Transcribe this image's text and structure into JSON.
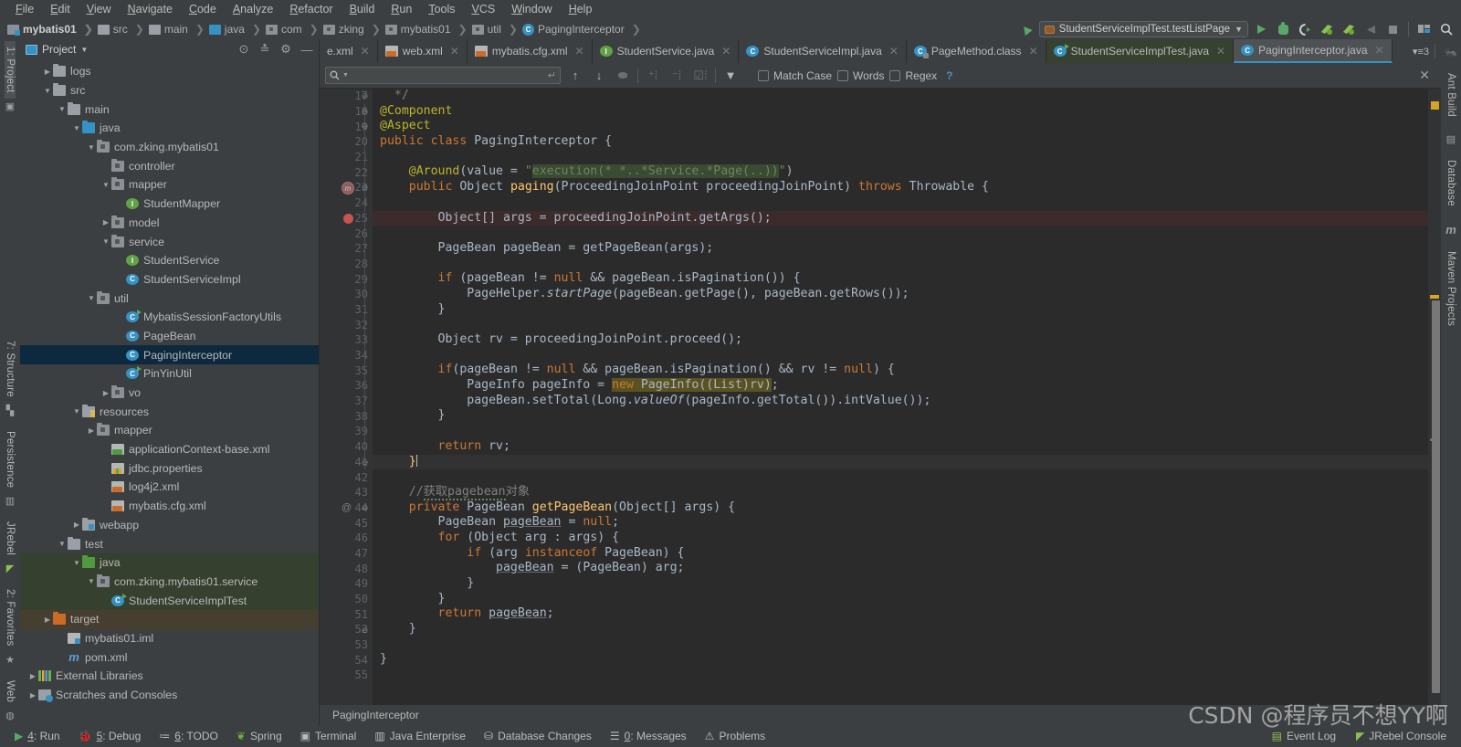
{
  "menu": {
    "items": [
      "File",
      "Edit",
      "View",
      "Navigate",
      "Code",
      "Analyze",
      "Refactor",
      "Build",
      "Run",
      "Tools",
      "VCS",
      "Window",
      "Help"
    ]
  },
  "breadcrumb": {
    "items": [
      {
        "label": "mybatis01",
        "icon": "module-icon"
      },
      {
        "label": "src",
        "icon": "folder-icon"
      },
      {
        "label": "main",
        "icon": "folder-icon"
      },
      {
        "label": "java",
        "icon": "source-folder-icon"
      },
      {
        "label": "com",
        "icon": "package-icon"
      },
      {
        "label": "zking",
        "icon": "package-icon"
      },
      {
        "label": "mybatis01",
        "icon": "package-icon"
      },
      {
        "label": "util",
        "icon": "package-icon"
      },
      {
        "label": "PagingInterceptor",
        "icon": "class-icon"
      }
    ]
  },
  "toolbar": {
    "run_config": "StudentServiceImplTest.testListPage",
    "buttons": [
      "run-button",
      "debug-button",
      "run-coverage-button",
      "run-with-jrebel-button",
      "debug-with-jrebel-button",
      "build-button",
      "stop-button",
      "select-target-button",
      "search-everywhere-button"
    ]
  },
  "left_rail": {
    "tabs": [
      "1: Project",
      "7: Structure",
      "Persistence",
      "JRebel",
      "2: Favorites",
      "Web"
    ]
  },
  "right_rail": {
    "tabs": [
      "Ant Build",
      "Database",
      "Maven Projects"
    ]
  },
  "project_panel": {
    "title": "Project",
    "tree": [
      {
        "label": "logs",
        "indent": 1,
        "arrow": "right",
        "icon": "folder"
      },
      {
        "label": "src",
        "indent": 1,
        "arrow": "down",
        "icon": "folder"
      },
      {
        "label": "main",
        "indent": 2,
        "arrow": "down",
        "icon": "folder"
      },
      {
        "label": "java",
        "indent": 3,
        "arrow": "down",
        "icon": "folder-blue"
      },
      {
        "label": "com.zking.mybatis01",
        "indent": 4,
        "arrow": "down",
        "icon": "package"
      },
      {
        "label": "controller",
        "indent": 5,
        "arrow": "none",
        "icon": "package"
      },
      {
        "label": "mapper",
        "indent": 5,
        "arrow": "down",
        "icon": "package"
      },
      {
        "label": "StudentMapper",
        "indent": 6,
        "arrow": "none",
        "icon": "interface"
      },
      {
        "label": "model",
        "indent": 5,
        "arrow": "right",
        "icon": "package"
      },
      {
        "label": "service",
        "indent": 5,
        "arrow": "down",
        "icon": "package"
      },
      {
        "label": "StudentService",
        "indent": 6,
        "arrow": "none",
        "icon": "interface"
      },
      {
        "label": "StudentServiceImpl",
        "indent": 6,
        "arrow": "none",
        "icon": "class"
      },
      {
        "label": "util",
        "indent": 4,
        "arrow": "down",
        "icon": "package"
      },
      {
        "label": "MybatisSessionFactoryUtils",
        "indent": 6,
        "arrow": "none",
        "icon": "class-runnable"
      },
      {
        "label": "PageBean",
        "indent": 6,
        "arrow": "none",
        "icon": "class"
      },
      {
        "label": "PagingInterceptor",
        "indent": 6,
        "arrow": "none",
        "icon": "class",
        "state": "selected"
      },
      {
        "label": "PinYinUtil",
        "indent": 6,
        "arrow": "none",
        "icon": "class-runnable"
      },
      {
        "label": "vo",
        "indent": 5,
        "arrow": "right",
        "icon": "package"
      },
      {
        "label": "resources",
        "indent": 3,
        "arrow": "down",
        "icon": "folder-resources"
      },
      {
        "label": "mapper",
        "indent": 4,
        "arrow": "right",
        "icon": "package"
      },
      {
        "label": "applicationContext-base.xml",
        "indent": 5,
        "arrow": "none",
        "icon": "xml-spring"
      },
      {
        "label": "jdbc.properties",
        "indent": 5,
        "arrow": "none",
        "icon": "properties"
      },
      {
        "label": "log4j2.xml",
        "indent": 5,
        "arrow": "none",
        "icon": "xml"
      },
      {
        "label": "mybatis.cfg.xml",
        "indent": 5,
        "arrow": "none",
        "icon": "xml"
      },
      {
        "label": "webapp",
        "indent": 3,
        "arrow": "right",
        "icon": "folder-web"
      },
      {
        "label": "test",
        "indent": 2,
        "arrow": "down",
        "icon": "folder"
      },
      {
        "label": "java",
        "indent": 3,
        "arrow": "down",
        "icon": "folder-green",
        "state": "green"
      },
      {
        "label": "com.zking.mybatis01.service",
        "indent": 4,
        "arrow": "down",
        "icon": "package",
        "state": "green"
      },
      {
        "label": "StudentServiceImplTest",
        "indent": 5,
        "arrow": "none",
        "icon": "class-runnable-green",
        "state": "green"
      },
      {
        "label": "target",
        "indent": 1,
        "arrow": "right",
        "icon": "folder-orange",
        "state": "brown"
      },
      {
        "label": "mybatis01.iml",
        "indent": 2,
        "arrow": "none",
        "icon": "iml"
      },
      {
        "label": "pom.xml",
        "indent": 2,
        "arrow": "none",
        "icon": "maven"
      },
      {
        "label": "External Libraries",
        "indent": 0,
        "arrow": "right",
        "icon": "libraries"
      },
      {
        "label": "Scratches and Consoles",
        "indent": 0,
        "arrow": "right",
        "icon": "scratches"
      }
    ]
  },
  "editor_tabs": [
    {
      "label": "e.xml",
      "icon": "xml",
      "state": "clipped"
    },
    {
      "label": "web.xml",
      "icon": "xml-web",
      "state": "normal"
    },
    {
      "label": "mybatis.cfg.xml",
      "icon": "xml",
      "state": "normal"
    },
    {
      "label": "StudentService.java",
      "icon": "interface",
      "state": "normal"
    },
    {
      "label": "StudentServiceImpl.java",
      "icon": "class",
      "state": "normal"
    },
    {
      "label": "PageMethod.class",
      "icon": "class-file",
      "state": "normal"
    },
    {
      "label": "StudentServiceImplTest.java",
      "icon": "class-runnable-green",
      "state": "green"
    },
    {
      "label": "PagingInterceptor.java",
      "icon": "class",
      "state": "selected"
    }
  ],
  "tabs_overflow_count": "3",
  "find_bar": {
    "placeholder": "",
    "value": "",
    "match_case": "Match Case",
    "words": "Words",
    "regex": "Regex",
    "help": "?"
  },
  "code": {
    "first_line": 17,
    "lines": [
      {
        "n": 17,
        "html": "  <span class='cm'>*/</span>"
      },
      {
        "n": 18,
        "html": "<span class='a'>@Component</span>"
      },
      {
        "n": 19,
        "html": "<span class='a'>@Aspect</span>"
      },
      {
        "n": 20,
        "html": "<span class='k'>public</span> <span class='k'>class</span> PagingInterceptor {"
      },
      {
        "n": 21,
        "html": ""
      },
      {
        "n": 22,
        "html": "    <span class='a'>@Around</span>(value = <span class='s'>\"</span><span class='sel s'>execution(* *..*Service.*Page(..))</span><span class='s'>\"</span>)"
      },
      {
        "n": 23,
        "html": "    <span class='k'>public</span> Object <span class='m'>paging</span>(ProceedingJoinPoint proceedingJoinPoint) <span class='k'>throws</span> Throwable {"
      },
      {
        "n": 24,
        "html": ""
      },
      {
        "n": 25,
        "html": "        Object[] args = proceedingJoinPoint.getArgs();",
        "hl": true
      },
      {
        "n": 26,
        "html": ""
      },
      {
        "n": 27,
        "html": "        PageBean pageBean = getPageBean(args);"
      },
      {
        "n": 28,
        "html": ""
      },
      {
        "n": 29,
        "html": "        <span class='k'>if</span> (pageBean != <span class='k'>null</span> &amp;&amp; pageBean.isPagination()) {"
      },
      {
        "n": 30,
        "html": "            PageHelper.<span style='font-style:italic'>startPage</span>(pageBean.getPage(), pageBean.getRows());"
      },
      {
        "n": 31,
        "html": "        }"
      },
      {
        "n": 32,
        "html": ""
      },
      {
        "n": 33,
        "html": "        Object rv = proceedingJoinPoint.proceed();"
      },
      {
        "n": 34,
        "html": ""
      },
      {
        "n": 35,
        "html": "        <span class='k'>if</span>(pageBean != <span class='k'>null</span> &amp;&amp; pageBean.isPagination() &amp;&amp; rv != <span class='k'>null</span>) {"
      },
      {
        "n": 36,
        "html": "            PageInfo pageInfo = <span class='hlw'><span class='k'>new</span> PageInfo((List)rv)</span>;"
      },
      {
        "n": 37,
        "html": "            pageBean.setTotal(Long.<span style='font-style:italic'>valueOf</span>(pageInfo.getTotal()).intValue());"
      },
      {
        "n": 38,
        "html": "        }"
      },
      {
        "n": 39,
        "html": ""
      },
      {
        "n": 40,
        "html": "        <span class='k'>return</span> rv;"
      },
      {
        "n": 41,
        "html": "    <span style='color:#ffc66d'>}</span><span class='caret'></span>",
        "cur": true
      },
      {
        "n": 42,
        "html": ""
      },
      {
        "n": 43,
        "html": "    <span class='cm'>//</span><span class='cm wavy'>获取pagebean</span><span class='cm'>对象</span>"
      },
      {
        "n": 44,
        "html": "    <span class='k'>private</span> PageBean <span class='m'>getPageBean</span>(Object[] args) {"
      },
      {
        "n": 45,
        "html": "        PageBean <span class='und'>pageBean</span> = <span class='k'>null</span>;"
      },
      {
        "n": 46,
        "html": "        <span class='k'>for</span> (Object arg : args) {"
      },
      {
        "n": 47,
        "html": "            <span class='k'>if</span> (arg <span class='k'>instanceof</span> PageBean) {"
      },
      {
        "n": 48,
        "html": "                <span class='und'>pageBean</span> = (PageBean) arg;"
      },
      {
        "n": 49,
        "html": "            }"
      },
      {
        "n": 50,
        "html": "        }"
      },
      {
        "n": 51,
        "html": "        <span class='k'>return</span> <span class='und'>pageBean</span>;"
      },
      {
        "n": 52,
        "html": "    }"
      },
      {
        "n": 53,
        "html": ""
      },
      {
        "n": 54,
        "html": "}"
      },
      {
        "n": 55,
        "html": ""
      }
    ]
  },
  "editor_status_crumb": "PagingInterceptor",
  "status_bar": {
    "items": [
      {
        "label": "4: Run",
        "icon": "run-icon"
      },
      {
        "label": "5: Debug",
        "icon": "debug-icon"
      },
      {
        "label": "6: TODO",
        "icon": "todo-icon"
      },
      {
        "label": "Spring",
        "icon": "spring-icon"
      },
      {
        "label": "Terminal",
        "icon": "terminal-icon"
      },
      {
        "label": "Java Enterprise",
        "icon": "java-enterprise-icon"
      },
      {
        "label": "Database Changes",
        "icon": "database-changes-icon"
      },
      {
        "label": "0: Messages",
        "icon": "messages-icon"
      },
      {
        "label": "Problems",
        "icon": "problems-icon"
      }
    ],
    "right_items": [
      {
        "label": "Event Log",
        "icon": "event-log-icon"
      },
      {
        "label": "JRebel Console",
        "icon": "jrebel-icon"
      }
    ]
  },
  "watermark": "CSDN @程序员不想YY啊",
  "colors": {
    "accent": "#3592c4",
    "panel_bg": "#3c3f41",
    "editor_bg": "#2b2b2b",
    "gutter_bg": "#313335",
    "selection": "#0d293e",
    "keyword": "#cc7832",
    "string": "#6a8759",
    "annotation": "#bbb529",
    "method": "#ffc66d",
    "comment": "#808080",
    "breakpoint": "#c75450",
    "green_run": "#59a869"
  }
}
